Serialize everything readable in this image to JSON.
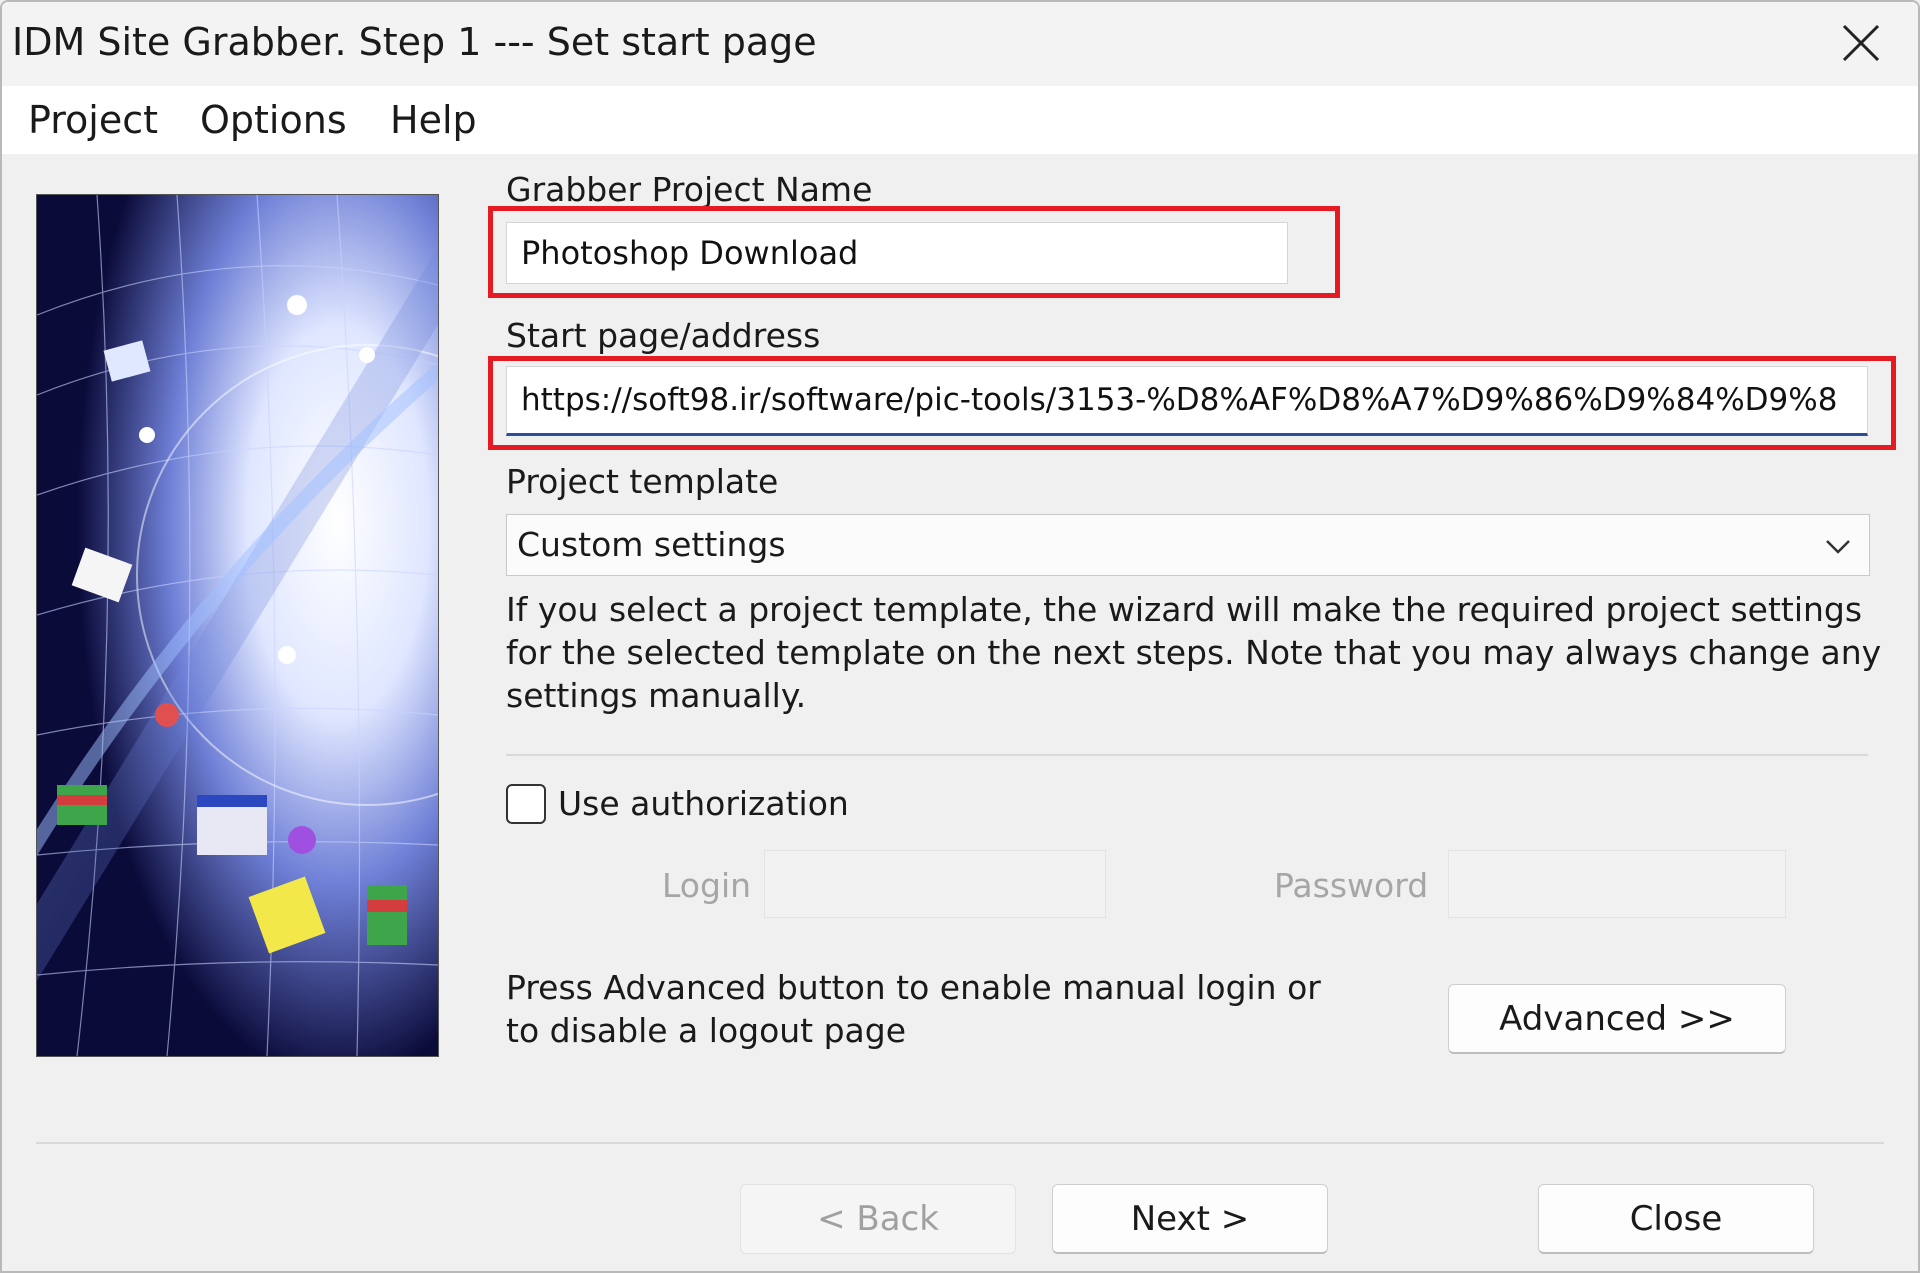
{
  "window": {
    "title": "IDM Site Grabber. Step 1 --- Set start page",
    "close_icon": "close-icon"
  },
  "menu": {
    "items": [
      "Project",
      "Options",
      "Help"
    ]
  },
  "form": {
    "project_name": {
      "label": "Grabber Project Name",
      "value": "Photoshop Download"
    },
    "start_page": {
      "label": "Start page/address",
      "value": "https://soft98.ir/software/pic-tools/3153-%D8%AF%D8%A7%D9%86%D9%84%D9%8"
    },
    "template": {
      "label": "Project template",
      "selected": "Custom settings"
    },
    "template_description": "If you select a project template, the wizard will make the required project settings for the selected template on the next steps. Note that you may always change any settings manually.",
    "authorization": {
      "checkbox_label": "Use authorization",
      "checked": false,
      "login_label": "Login",
      "password_label": "Password",
      "login_value": "",
      "password_value": ""
    },
    "advanced": {
      "note": "Press Advanced button to enable manual login or to disable a logout page",
      "button_label": "Advanced >>"
    }
  },
  "footer": {
    "back_label": "< Back",
    "next_label": "Next >",
    "close_label": "Close"
  },
  "colors": {
    "highlight": "#e41b23",
    "focus_underline": "#2b4e9b"
  }
}
